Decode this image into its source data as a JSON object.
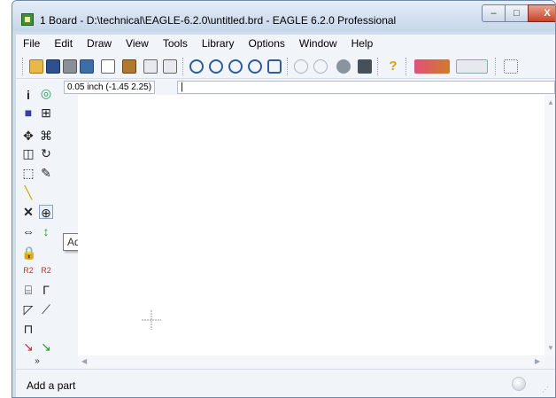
{
  "window": {
    "title": "1 Board - D:\\technical\\EAGLE-6.2.0\\untitled.brd - EAGLE 6.2.0 Professional",
    "minimize_glyph": "–",
    "maximize_glyph": "□",
    "close_glyph": "X"
  },
  "menubar": {
    "items": [
      "File",
      "Edit",
      "Draw",
      "View",
      "Tools",
      "Library",
      "Options",
      "Window",
      "Help"
    ]
  },
  "toolbar": {
    "icons": [
      "open-icon",
      "save-icon",
      "print-icon",
      "cam-icon",
      "board-schematic-icon",
      "library-icon",
      "script-icon",
      "ulp-icon",
      "zoom-fit-icon",
      "zoom-in-icon",
      "zoom-out-icon",
      "zoom-select-icon",
      "redraw-icon",
      "undo-icon",
      "redo-icon",
      "stop-icon",
      "go-icon",
      "help-icon",
      "design-link-icon",
      "pcb-quote-icon",
      "grid-icon"
    ]
  },
  "command": {
    "coordinates": "0.05 inch (-1.45 2.25)",
    "input_value": "|"
  },
  "tooltip": {
    "text": "Add"
  },
  "status": {
    "text": "Add a part"
  }
}
